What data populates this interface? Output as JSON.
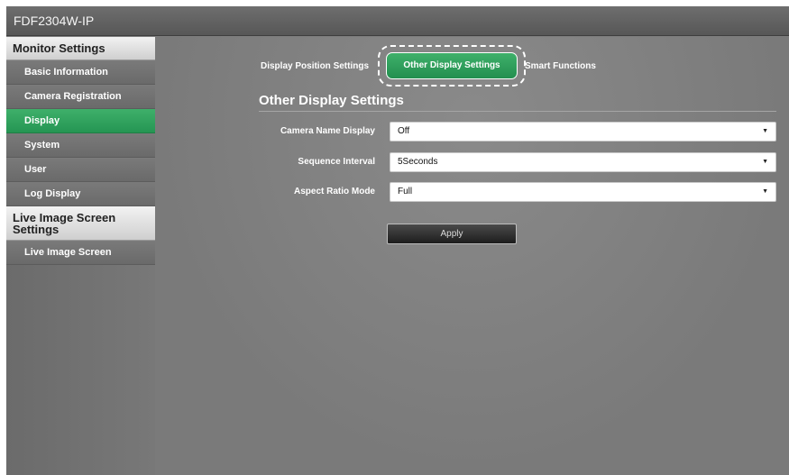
{
  "window": {
    "title": "FDF2304W-IP"
  },
  "sidebar": {
    "sections": [
      {
        "label": "Monitor Settings"
      },
      {
        "label": "Live Image Screen Settings"
      }
    ],
    "monitor_items": [
      {
        "label": "Basic Information"
      },
      {
        "label": "Camera Registration"
      },
      {
        "label": "Display",
        "active": true
      },
      {
        "label": "System"
      },
      {
        "label": "User"
      },
      {
        "label": "Log Display"
      }
    ],
    "live_items": [
      {
        "label": "Live Image Screen"
      }
    ]
  },
  "tabs": [
    {
      "label": "Display Position Settings"
    },
    {
      "label": "Other Display Settings",
      "active": true
    },
    {
      "label": "Smart Functions"
    }
  ],
  "page": {
    "title": "Other Display Settings"
  },
  "form": {
    "camera_name_display": {
      "label": "Camera Name Display",
      "value": "Off"
    },
    "sequence_interval": {
      "label": "Sequence Interval",
      "value": "5Seconds"
    },
    "aspect_ratio_mode": {
      "label": "Aspect Ratio Mode",
      "value": "Full"
    },
    "apply_label": "Apply"
  },
  "icons": {
    "dropdown": "caret-down-icon"
  },
  "colors": {
    "accent": "#259553",
    "titlebar": "#5e5e5e"
  }
}
